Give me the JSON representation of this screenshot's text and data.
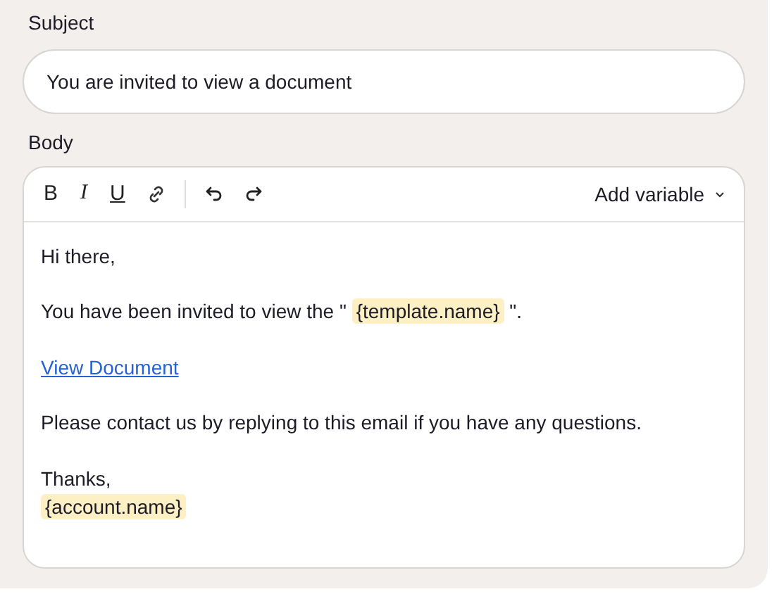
{
  "subject": {
    "label": "Subject",
    "value": "You are invited to view a document"
  },
  "body": {
    "label": "Body",
    "toolbar": {
      "tools": [
        {
          "kind": "bold",
          "label": "B"
        },
        {
          "kind": "italic",
          "label": "I"
        },
        {
          "kind": "underline",
          "label": "U"
        },
        {
          "kind": "link"
        },
        {
          "kind": "divider"
        },
        {
          "kind": "undo"
        },
        {
          "kind": "redo"
        }
      ],
      "add_variable": "Add variable"
    },
    "paragraphs": [
      {
        "lines": [
          [
            {
              "kind": "text",
              "text": "Hi there,"
            }
          ]
        ]
      },
      {
        "lines": [
          [
            {
              "kind": "text",
              "text": "You have been invited to view the \" "
            },
            {
              "kind": "variable",
              "text": "{template.name}"
            },
            {
              "kind": "text",
              "text": " \"."
            }
          ]
        ]
      },
      {
        "lines": [
          [
            {
              "kind": "link",
              "text": "View Document"
            }
          ]
        ]
      },
      {
        "lines": [
          [
            {
              "kind": "text",
              "text": "Please contact us by replying to this email if you have any questions."
            }
          ]
        ]
      },
      {
        "lines": [
          [
            {
              "kind": "text",
              "text": "Thanks,"
            }
          ],
          [
            {
              "kind": "variable",
              "text": "{account.name}"
            }
          ]
        ]
      }
    ]
  }
}
